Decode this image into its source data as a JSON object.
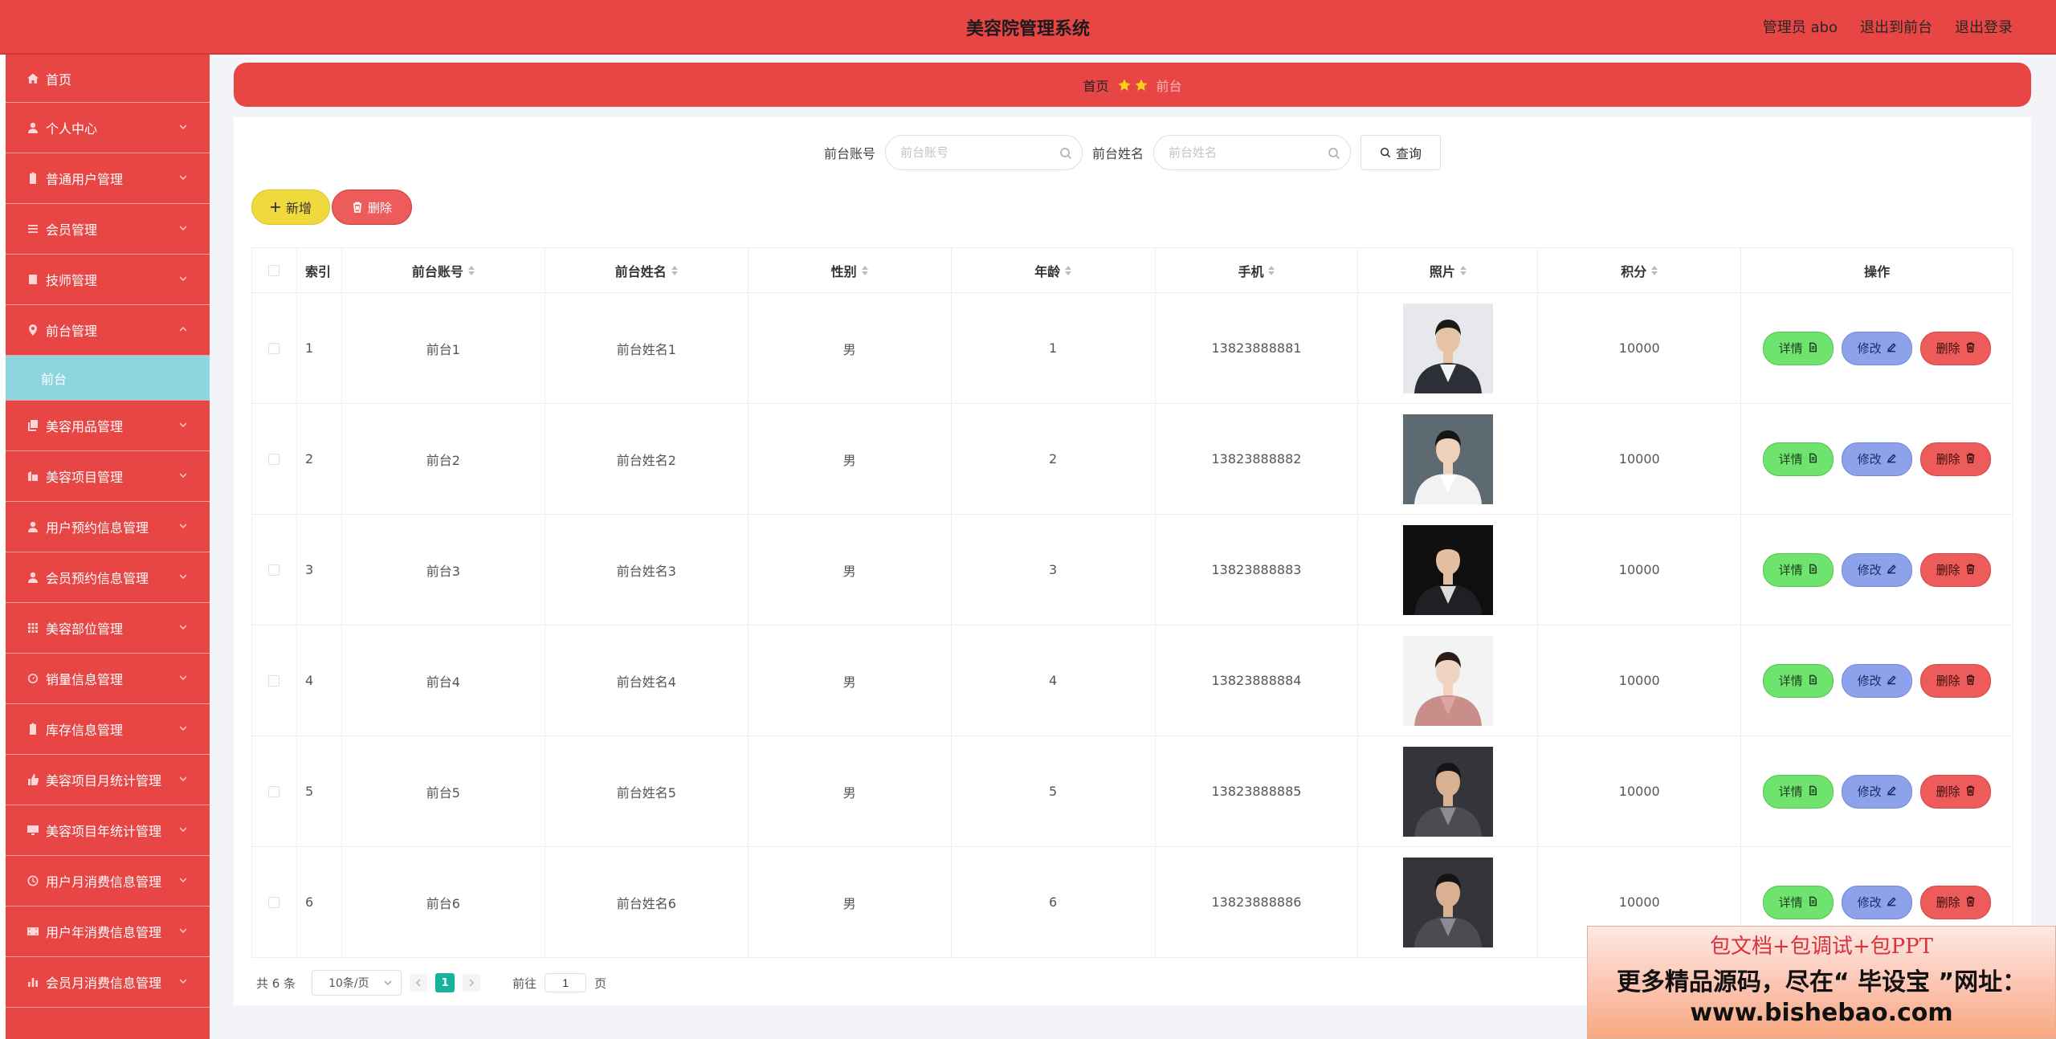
{
  "header": {
    "title": "美容院管理系统",
    "admin_label": "管理员 abo",
    "front_link": "退出到前台",
    "logout_link": "退出登录"
  },
  "sidebar": {
    "items": [
      {
        "label": "首页",
        "icon": "home-icon"
      },
      {
        "label": "个人中心",
        "icon": "user-icon"
      },
      {
        "label": "普通用户管理",
        "icon": "clipboard-icon"
      },
      {
        "label": "会员管理",
        "icon": "list-icon"
      },
      {
        "label": "技师管理",
        "icon": "book-icon"
      },
      {
        "label": "前台管理",
        "icon": "location-icon",
        "expanded": true
      },
      {
        "label": "美容用品管理",
        "icon": "copy-icon"
      },
      {
        "label": "美容项目管理",
        "icon": "building-icon"
      },
      {
        "label": "用户预约信息管理",
        "icon": "user-icon"
      },
      {
        "label": "会员预约信息管理",
        "icon": "user-icon"
      },
      {
        "label": "美容部位管理",
        "icon": "grid-icon"
      },
      {
        "label": "销量信息管理",
        "icon": "gauge-icon"
      },
      {
        "label": "库存信息管理",
        "icon": "clipboard-icon"
      },
      {
        "label": "美容项目月统计管理",
        "icon": "thumb-icon"
      },
      {
        "label": "美容项目年统计管理",
        "icon": "monitor-icon"
      },
      {
        "label": "用户月消费信息管理",
        "icon": "clock-icon"
      },
      {
        "label": "用户年消费信息管理",
        "icon": "film-icon"
      },
      {
        "label": "会员月消费信息管理",
        "icon": "bar-chart-icon"
      }
    ],
    "sub_item": "前台"
  },
  "breadcrumb": {
    "home": "首页",
    "current": "前台"
  },
  "search": {
    "account_label": "前台账号",
    "account_placeholder": "前台账号",
    "name_label": "前台姓名",
    "name_placeholder": "前台姓名",
    "query_button": "查询"
  },
  "toolbar": {
    "add_label": "新增",
    "delete_label": "删除"
  },
  "table": {
    "columns": [
      "索引",
      "前台账号",
      "前台姓名",
      "性别",
      "年龄",
      "手机",
      "照片",
      "积分",
      "操作"
    ],
    "rows": [
      {
        "index": "1",
        "account": "前台1",
        "name": "前台姓名1",
        "sex": "男",
        "age": "1",
        "phone": "13823888881",
        "points": "10000"
      },
      {
        "index": "2",
        "account": "前台2",
        "name": "前台姓名2",
        "sex": "男",
        "age": "2",
        "phone": "13823888882",
        "points": "10000"
      },
      {
        "index": "3",
        "account": "前台3",
        "name": "前台姓名3",
        "sex": "男",
        "age": "3",
        "phone": "13823888883",
        "points": "10000"
      },
      {
        "index": "4",
        "account": "前台4",
        "name": "前台姓名4",
        "sex": "男",
        "age": "4",
        "phone": "13823888884",
        "points": "10000"
      },
      {
        "index": "5",
        "account": "前台5",
        "name": "前台姓名5",
        "sex": "男",
        "age": "5",
        "phone": "13823888885",
        "points": "10000"
      },
      {
        "index": "6",
        "account": "前台6",
        "name": "前台姓名6",
        "sex": "男",
        "age": "6",
        "phone": "13823888886",
        "points": "10000"
      }
    ],
    "ops": {
      "detail": "详情",
      "edit": "修改",
      "delete": "删除"
    }
  },
  "pagination": {
    "total_text": "共 6 条",
    "page_size": "10条/页",
    "current_page": "1",
    "goto_label": "前往",
    "goto_value": "1",
    "page_unit": "页"
  },
  "watermark": {
    "line1": "包文档+包调试+包PPT",
    "line2": "更多精品源码，尽在“ 毕设宝 ”网址：",
    "line3": "www.bishebao.com"
  },
  "colors": {
    "primary_red": "#e84545",
    "sub_item_bg": "#8ed5df",
    "add_yellow": "#f0d93c",
    "detail_green": "#6ee46e",
    "edit_blue": "#8ea2ec",
    "page_active": "#17b29a"
  }
}
